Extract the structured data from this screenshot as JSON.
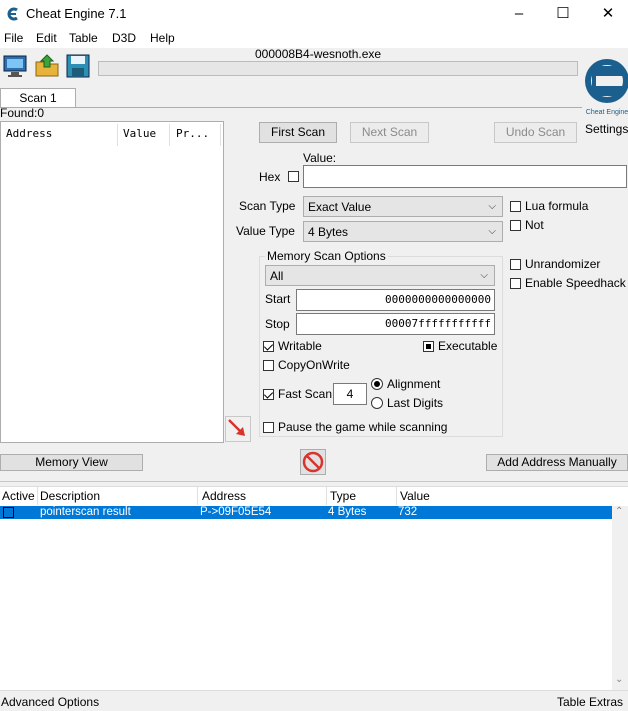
{
  "window": {
    "title": "Cheat Engine 7.1",
    "process_name": "000008B4-wesnoth.exe",
    "minimize": "–",
    "maximize": "☐",
    "close": "✕"
  },
  "menu": [
    "File",
    "Edit",
    "Table",
    "D3D",
    "Help"
  ],
  "scan_tab": "Scan 1",
  "found": "Found:0",
  "results_columns": [
    "Address",
    "Value",
    "Pr..."
  ],
  "buttons": {
    "first_scan": "First Scan",
    "next_scan": "Next Scan",
    "undo_scan": "Undo Scan",
    "memory_view": "Memory View",
    "add_address": "Add Address Manually"
  },
  "settings_label": "Settings",
  "value_label": "Value:",
  "hex_label": "Hex",
  "scan_type": {
    "label": "Scan Type",
    "value": "Exact Value"
  },
  "value_type": {
    "label": "Value Type",
    "value": "4 Bytes"
  },
  "options": {
    "lua_formula": "Lua formula",
    "not": "Not",
    "unrandomizer": "Unrandomizer",
    "speedhack": "Enable Speedhack"
  },
  "memory_scan": {
    "title": "Memory Scan Options",
    "region": "All",
    "start_label": "Start",
    "start": "0000000000000000",
    "stop_label": "Stop",
    "stop": "00007fffffffffff",
    "writable": "Writable",
    "executable": "Executable",
    "copy_on_write": "CopyOnWrite",
    "fast_scan": "Fast Scan",
    "fast_scan_value": "4",
    "alignment": "Alignment",
    "last_digits": "Last Digits",
    "pause": "Pause the game while scanning"
  },
  "table": {
    "columns": [
      "Active",
      "Description",
      "Address",
      "Type",
      "Value"
    ],
    "rows": [
      {
        "description": "pointerscan result",
        "address": "P->09F05E54",
        "type": "4 Bytes",
        "value": "732"
      }
    ]
  },
  "footer": {
    "advanced": "Advanced Options",
    "extras": "Table Extras"
  },
  "colors": {
    "selection": "#0078d7",
    "accent_red": "#d8332c",
    "logo_blue": "#1b5f8e"
  }
}
